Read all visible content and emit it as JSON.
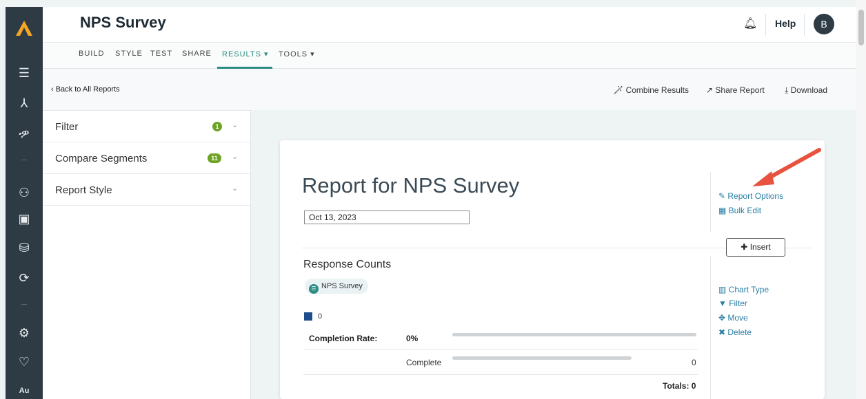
{
  "header": {
    "title": "NPS Survey",
    "help": "Help",
    "avatar": "B"
  },
  "nav": {
    "tabs": [
      "BUILD",
      "STYLE",
      "TEST",
      "SHARE",
      "RESULTS ▾",
      "TOOLS ▾"
    ],
    "active": "RESULTS"
  },
  "actions": {
    "back": "‹ Back to All Reports",
    "combine": "Combine Results",
    "share": "Share Report",
    "download": "Download"
  },
  "panel": {
    "filter": {
      "label": "Filter",
      "badge": "1"
    },
    "compare": {
      "label": "Compare Segments",
      "badge": "11"
    },
    "style": {
      "label": "Report Style"
    }
  },
  "report": {
    "title": "Report for NPS Survey",
    "date": "Oct 13, 2023",
    "report_options": "Report Options",
    "bulk_edit": "Bulk Edit",
    "insert": "Insert"
  },
  "question": {
    "title": "Response Counts",
    "survey_tag": "NPS Survey",
    "legend": "0",
    "completion_label": "Completion Rate:",
    "completion_value": "0%",
    "complete_label": "Complete",
    "complete_value": "0",
    "totals": "Totals: 0",
    "chart_type": "Chart Type",
    "filter": "Filter",
    "move": "Move",
    "delete": "Delete"
  },
  "colors": {
    "accent": "#2a8c83",
    "badge": "#6ea325",
    "link": "#2a7fa6",
    "rail": "#2e3b45",
    "arrow": "#e8533f",
    "legend": "#1e4f8a"
  }
}
